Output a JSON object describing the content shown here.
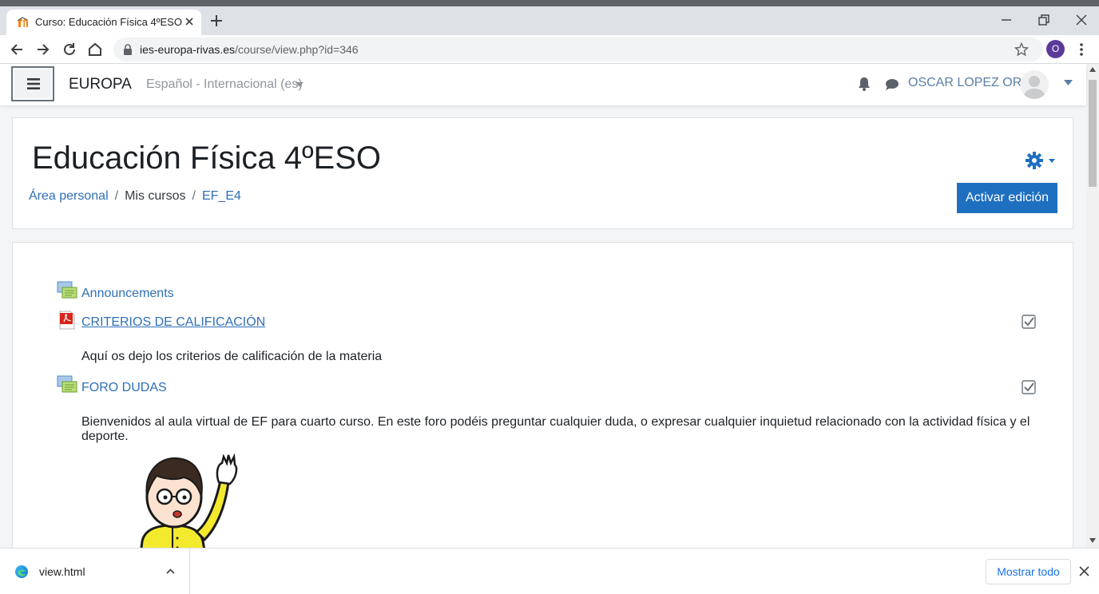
{
  "browser": {
    "tab_title": "Curso: Educación Física 4ºESO",
    "url_host": "ies-europa-rivas.es",
    "url_path": "/course/view.php?id=346",
    "profile_initial": "O"
  },
  "navbar": {
    "site_name": "EUROPA",
    "language": "Español - Internacional (es)",
    "user_name": "OSCAR LOPEZ OROL"
  },
  "course": {
    "title": "Educación Física 4ºESO",
    "breadcrumb": [
      "Área personal",
      "Mis cursos",
      "EF_E4"
    ],
    "edit_button": "Activar edición"
  },
  "activities": [
    {
      "name": "Announcements",
      "icon": "forum-icon",
      "description": ""
    },
    {
      "name": "CRITERIOS DE CALIFICACIÓN",
      "icon": "pdf-icon",
      "description": "Aquí os dejo los criterios de calificación de la materia"
    },
    {
      "name": "FORO DUDAS",
      "icon": "forum-icon",
      "description": "Bienvenidos al aula virtual de EF para cuarto curso. En este foro podéis preguntar cualquier duda, o expresar cualquier inquietud relacionado con la actividad física y el deporte."
    }
  ],
  "downloads": {
    "file_name": "view.html",
    "show_all": "Mostrar todo"
  },
  "colors": {
    "link": "#2f6fb6",
    "primary_button": "#1f6fc0",
    "page_background": "#f4f5f6"
  }
}
